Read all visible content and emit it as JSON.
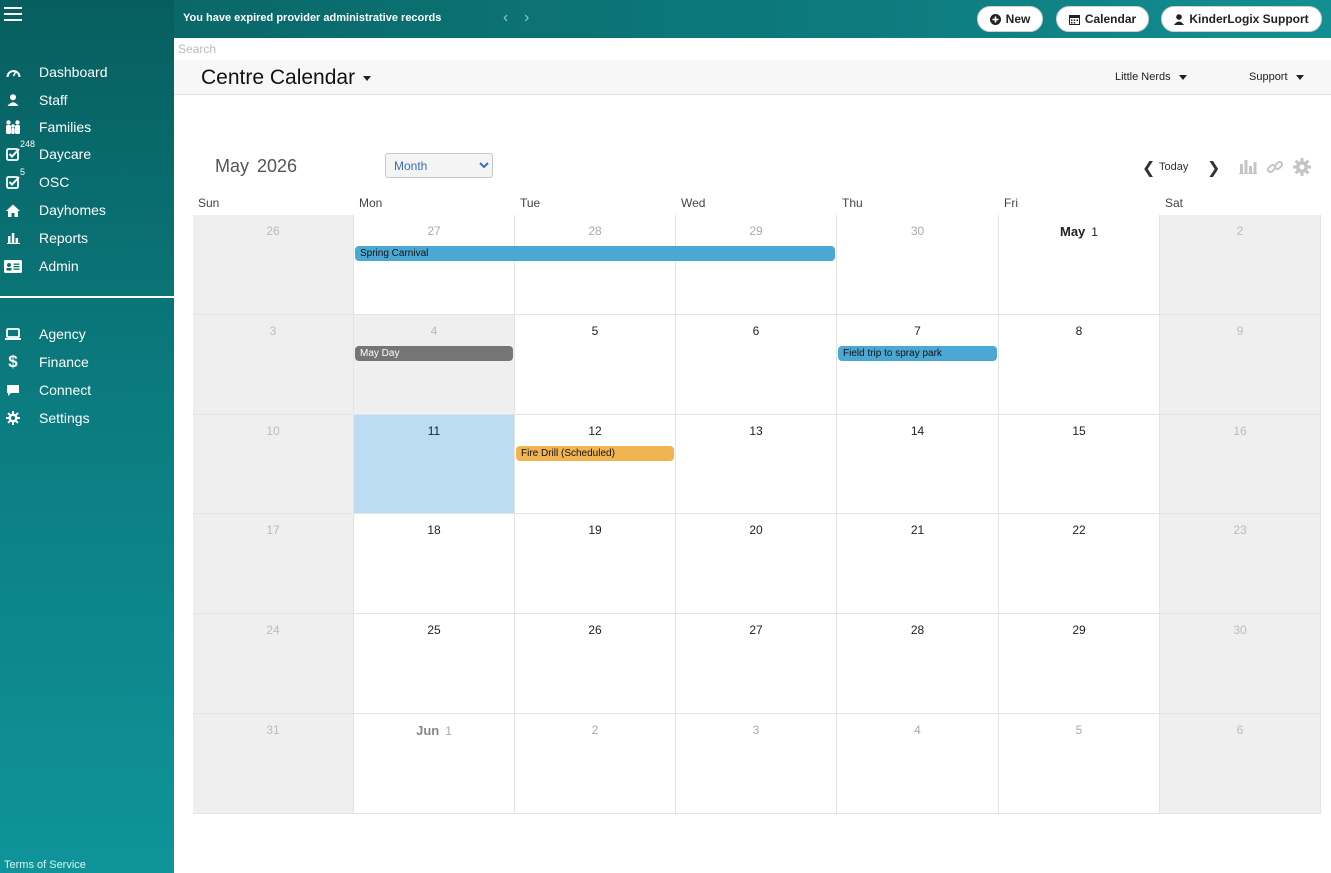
{
  "topbar": {
    "alert": "You have expired provider administrative records",
    "new_label": "New",
    "calendar_label": "Calendar",
    "support_label": "KinderLogix Support"
  },
  "sidebar": {
    "items": [
      {
        "label": "Dashboard",
        "icon": "gauge-icon"
      },
      {
        "label": "Staff",
        "icon": "user-icon"
      },
      {
        "label": "Families",
        "icon": "family-icon"
      },
      {
        "label": "Daycare",
        "icon": "checkbox-icon",
        "badge": "248"
      },
      {
        "label": "OSC",
        "icon": "checkbox-icon",
        "badge": "5"
      },
      {
        "label": "Dayhomes",
        "icon": "home-icon"
      },
      {
        "label": "Reports",
        "icon": "bar-chart-icon"
      },
      {
        "label": "Admin",
        "icon": "id-card-icon"
      }
    ],
    "items2": [
      {
        "label": "Agency",
        "icon": "laptop-icon"
      },
      {
        "label": "Finance",
        "icon": "dollar-icon"
      },
      {
        "label": "Connect",
        "icon": "chat-icon"
      },
      {
        "label": "Settings",
        "icon": "gear-icon"
      }
    ],
    "terms": "Terms of Service"
  },
  "search": {
    "placeholder": "Search",
    "value": ""
  },
  "header": {
    "title": "Centre Calendar",
    "centre": "Little Nerds",
    "support": "Support"
  },
  "calendar": {
    "month": "May",
    "year": "2026",
    "view": "Month",
    "view_options": [
      "Month"
    ],
    "today_label": "Today",
    "weekdays": [
      "Sun",
      "Mon",
      "Tue",
      "Wed",
      "Thu",
      "Fri",
      "Sat"
    ],
    "weeks": [
      [
        {
          "d": "26",
          "o": true
        },
        {
          "d": "27",
          "o": true
        },
        {
          "d": "28",
          "o": true
        },
        {
          "d": "29",
          "o": true
        },
        {
          "d": "30",
          "o": true
        },
        {
          "d": "1",
          "m": "May"
        },
        {
          "d": "2"
        }
      ],
      [
        {
          "d": "3"
        },
        {
          "d": "4",
          "g": true
        },
        {
          "d": "5"
        },
        {
          "d": "6"
        },
        {
          "d": "7"
        },
        {
          "d": "8"
        },
        {
          "d": "9"
        }
      ],
      [
        {
          "d": "10"
        },
        {
          "d": "11",
          "t": true
        },
        {
          "d": "12"
        },
        {
          "d": "13"
        },
        {
          "d": "14"
        },
        {
          "d": "15"
        },
        {
          "d": "16"
        }
      ],
      [
        {
          "d": "17"
        },
        {
          "d": "18"
        },
        {
          "d": "19"
        },
        {
          "d": "20"
        },
        {
          "d": "21"
        },
        {
          "d": "22"
        },
        {
          "d": "23"
        }
      ],
      [
        {
          "d": "24"
        },
        {
          "d": "25"
        },
        {
          "d": "26"
        },
        {
          "d": "27"
        },
        {
          "d": "28"
        },
        {
          "d": "29"
        },
        {
          "d": "30"
        }
      ],
      [
        {
          "d": "31"
        },
        {
          "d": "1",
          "m": "Jun",
          "o": true
        },
        {
          "d": "2",
          "o": true
        },
        {
          "d": "3",
          "o": true
        },
        {
          "d": "4",
          "o": true
        },
        {
          "d": "5",
          "o": true
        },
        {
          "d": "6"
        }
      ]
    ],
    "events": [
      {
        "title": "Spring Carnival",
        "week": 0,
        "start": 1,
        "span": 3,
        "color": "#4aa8d3"
      },
      {
        "title": "May Day",
        "week": 1,
        "start": 1,
        "span": 1,
        "color": "#757575",
        "text": "#ffffff"
      },
      {
        "title": "Field trip to spray park",
        "week": 1,
        "start": 4,
        "span": 1,
        "color": "#4aa8d3"
      },
      {
        "title": "Fire Drill (Scheduled)",
        "week": 2,
        "start": 2,
        "span": 1,
        "color": "#f0b451"
      }
    ]
  }
}
